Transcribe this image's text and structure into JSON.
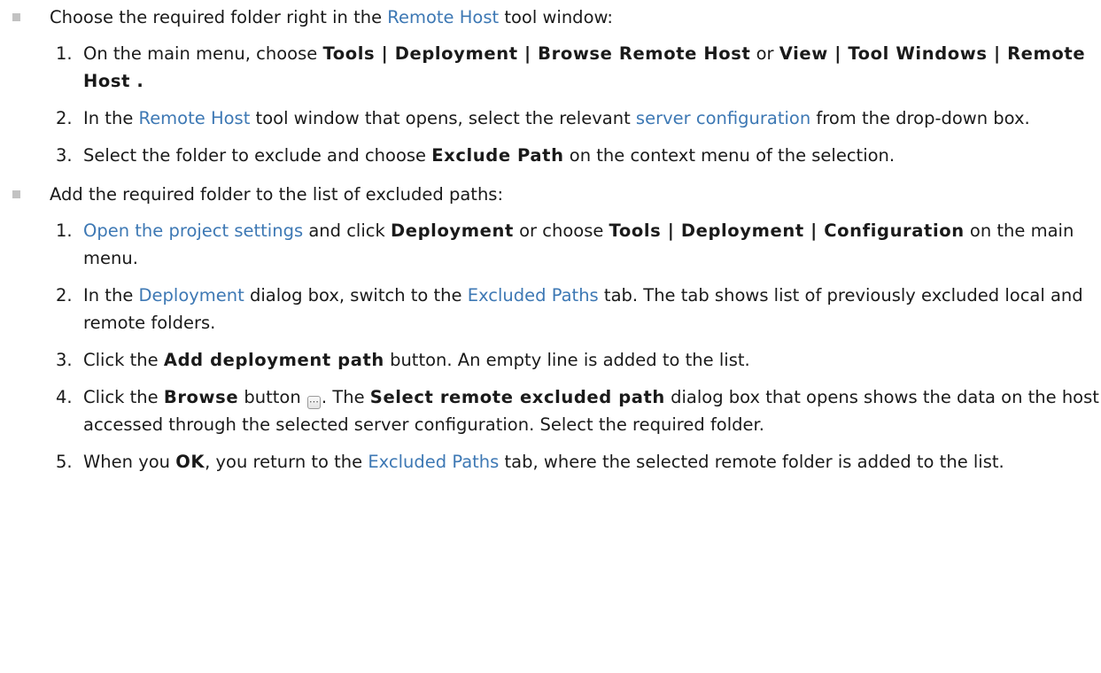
{
  "sections": [
    {
      "intro": [
        "Choose the required folder right in the ",
        "Remote Host",
        " tool window:"
      ],
      "steps": [
        {
          "num": "1.",
          "parts": [
            "On the main menu, choose ",
            "Tools | Deployment | Browse Remote Host",
            " or ",
            "View | Tool Windows | Remote Host",
            " ."
          ]
        },
        {
          "num": "2.",
          "parts": [
            "In the ",
            "Remote Host",
            " tool window that opens, select the relevant ",
            "server configuration",
            " from the drop-down box."
          ]
        },
        {
          "num": "3.",
          "parts": [
            "Select the folder to exclude and choose ",
            "Exclude Path",
            " on the context menu of the selection."
          ]
        }
      ]
    },
    {
      "intro": [
        "Add the required folder to the list of excluded paths:"
      ],
      "steps": [
        {
          "num": "1.",
          "parts": [
            "Open the project settings",
            " and click ",
            "Deployment",
            " or choose ",
            "Tools | Deployment | Configuration",
            " on the main menu."
          ]
        },
        {
          "num": "2.",
          "parts": [
            "In the ",
            "Deployment",
            " dialog box, switch to the ",
            "Excluded Paths",
            " tab. The tab shows list of previously excluded local and remote folders."
          ]
        },
        {
          "num": "3.",
          "parts": [
            "Click the ",
            "Add deployment path",
            " button. An empty line is added to the list."
          ]
        },
        {
          "num": "4.",
          "parts": [
            "Click the ",
            "Browse",
            " button ",
            ". The ",
            "Select remote excluded path",
            " dialog box that opens shows the data on the host accessed through the selected server configuration. Select the required folder."
          ]
        },
        {
          "num": "5.",
          "parts": [
            "When you ",
            "OK",
            ", you return to the ",
            "Excluded Paths",
            " tab, where the selected remote folder is added to the list."
          ]
        }
      ]
    }
  ],
  "icons": {
    "bullet": "square-bullet-icon",
    "browse": "ellipsis-browse-icon"
  },
  "colors": {
    "link": "#3d78b4",
    "text": "#1a1a1a",
    "bullet": "#c2c2c2"
  }
}
